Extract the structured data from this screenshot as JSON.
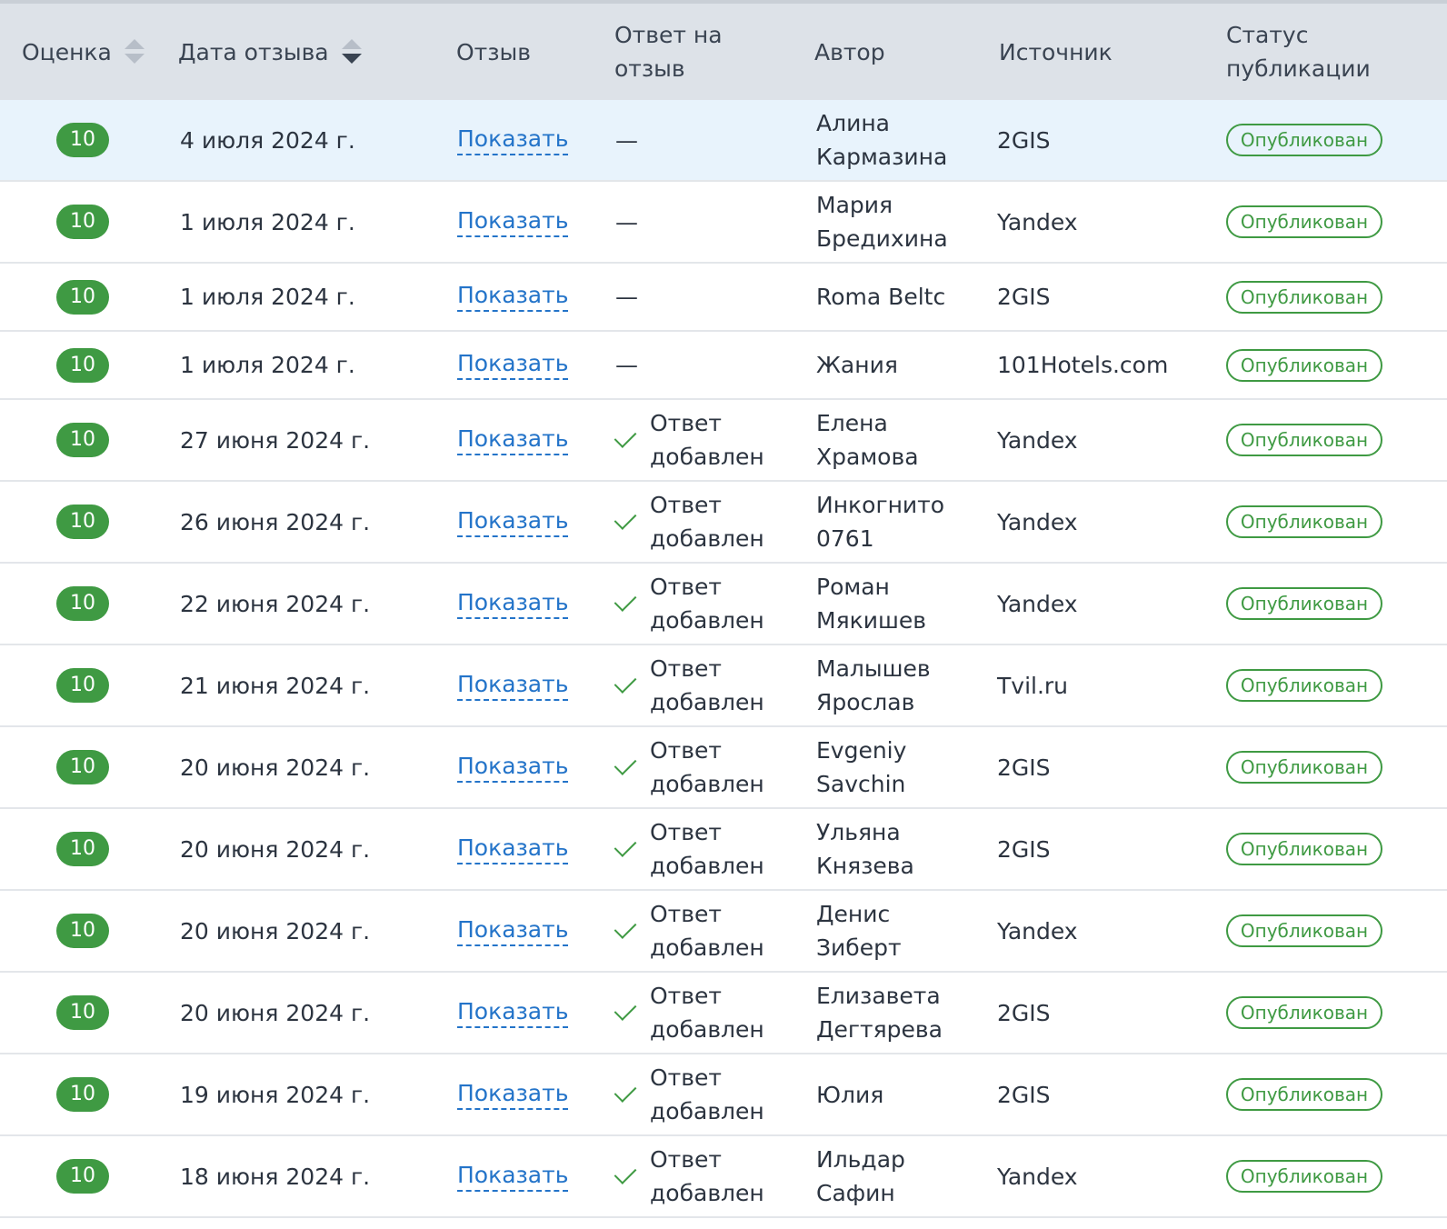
{
  "header": {
    "score": "Оценка",
    "date": "Дата отзыва",
    "review": "Отзыв",
    "reply": "Ответ на отзыв",
    "author": "Автор",
    "source": "Источник",
    "status": "Статус публикации"
  },
  "rows": [
    {
      "score": "10",
      "date": "4 июля 2024 г.",
      "review": "Показать",
      "reply": "—",
      "author": "Алина Кармазина",
      "source": "2GIS",
      "status": "Опубликован"
    },
    {
      "score": "10",
      "date": "1 июля 2024 г.",
      "review": "Показать",
      "reply": "—",
      "author": "Мария Бредихина",
      "source": "Yandex",
      "status": "Опубликован"
    },
    {
      "score": "10",
      "date": "1 июля 2024 г.",
      "review": "Показать",
      "reply": "—",
      "author": "Roma Beltc",
      "source": "2GIS",
      "status": "Опубликован"
    },
    {
      "score": "10",
      "date": "1 июля 2024 г.",
      "review": "Показать",
      "reply": "—",
      "author": "Жания",
      "source": "101Hotels.com",
      "status": "Опубликован"
    },
    {
      "score": "10",
      "date": "27 июня 2024 г.",
      "review": "Показать",
      "reply": "Ответ добавлен",
      "author": "Елена Храмова",
      "source": "Yandex",
      "status": "Опубликован"
    },
    {
      "score": "10",
      "date": "26 июня 2024 г.",
      "review": "Показать",
      "reply": "Ответ добавлен",
      "author": "Инкогнито 0761",
      "source": "Yandex",
      "status": "Опубликован"
    },
    {
      "score": "10",
      "date": "22 июня 2024 г.",
      "review": "Показать",
      "reply": "Ответ добавлен",
      "author": "Роман Мякишев",
      "source": "Yandex",
      "status": "Опубликован"
    },
    {
      "score": "10",
      "date": "21 июня 2024 г.",
      "review": "Показать",
      "reply": "Ответ добавлен",
      "author": "Малышев Ярослав",
      "source": "Tvil.ru",
      "status": "Опубликован"
    },
    {
      "score": "10",
      "date": "20 июня 2024 г.",
      "review": "Показать",
      "reply": "Ответ добавлен",
      "author": "Evgeniy Savchin",
      "source": "2GIS",
      "status": "Опубликован"
    },
    {
      "score": "10",
      "date": "20 июня 2024 г.",
      "review": "Показать",
      "reply": "Ответ добавлен",
      "author": "Ульяна Князева",
      "source": "2GIS",
      "status": "Опубликован"
    },
    {
      "score": "10",
      "date": "20 июня 2024 г.",
      "review": "Показать",
      "reply": "Ответ добавлен",
      "author": "Денис Зиберт",
      "source": "Yandex",
      "status": "Опубликован"
    },
    {
      "score": "10",
      "date": "20 июня 2024 г.",
      "review": "Показать",
      "reply": "Ответ добавлен",
      "author": "Елизавета Дегтярева",
      "source": "2GIS",
      "status": "Опубликован"
    },
    {
      "score": "10",
      "date": "19 июня 2024 г.",
      "review": "Показать",
      "reply": "Ответ добавлен",
      "author": "Юлия",
      "source": "2GIS",
      "status": "Опубликован"
    },
    {
      "score": "10",
      "date": "18 июня 2024 г.",
      "review": "Показать",
      "reply": "Ответ добавлен",
      "author": "Ильдар Сафин",
      "source": "Yandex",
      "status": "Опубликован"
    }
  ],
  "colors": {
    "accent_green": "#3f9a43",
    "link_blue": "#2474c9",
    "header_bg": "#dde2e8",
    "highlight_row_bg": "#e8f3fc"
  },
  "icons": {
    "sort": "sort-arrows-icon",
    "check": "checkmark-icon"
  }
}
